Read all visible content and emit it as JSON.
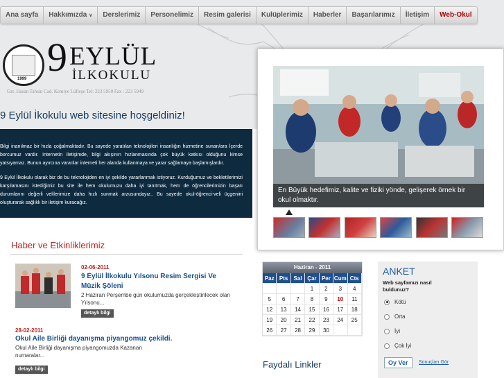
{
  "nav": {
    "items": [
      "Ana sayfa",
      "Hakkımızda",
      "Derslerimiz",
      "Personelimiz",
      "Resim galerisi",
      "Kulüplerimiz",
      "Haberler",
      "Başarılarımız",
      "İletişim",
      "Web-Okul"
    ]
  },
  "header": {
    "logo_number": "9",
    "logo_name": "EYLÜL",
    "logo_sub": "İLKOKULU",
    "seal_text": "9 EYLÜL İLKOKULU MÜDÜRLÜĞÜ",
    "seal_year": "1999",
    "address": "Gzt. Hasan Tahsin Cad. Kemiye Lüfleşe Tel: 223 5950  Fax : 223 5949"
  },
  "welcome": {
    "title": "9 Eylül İkokulu web sitesine hoşgeldiniz!",
    "paragraphs": [
      "Bilgi inanılmaz bir hızla çoğalmaktadır. Bu sayede yaratılan teknolojileri insanlığın hizmetine sunan/ara İçerde borcumuz vardır. Internetin iletişimde, bilgi akışının hızlanmasında çok büyük katkısı olduğunu kimse yatsıyamaz. Bunun ayırcına varanlar interneti her alanda kullanmaya ve yarar sağlamaya başlamışlardır.",
      "9 Eylül İlkokulu olarak biz de bu teknolojiden en iyi şekilde yararlanmak istiyoruz. Kurduğumuz ve bekletilerimizi karşılamasını istediğimiz bu site ile hem okulumuzu daha iyi tanıtmak, hem de öğrencilerimizin başarı durumlarını değerli velilerimize daha hızlı sunmak arzusundayız.. Bu sayede okul-öğrenci-veli üçgenini oluşturarak sağlıklı bir iletişim kuracağız."
    ]
  },
  "slider": {
    "caption": "En Büyük hedefimiz, kalite ve fiziki yönde, gelişerek örnek  bir okul olmaktır."
  },
  "news": {
    "title": "Haber ve Etkinliklerimiz",
    "items": [
      {
        "date": "02-06-2011",
        "title": "9 Eylül İlkokulu Yılsonu Resim Sergisi Ve Müzik Şöleni",
        "summary": "2 Haziran Perşembe gün okulumuzda gerçekleştirilecek olan Yılsonu...",
        "button": "detaylı bilgi"
      },
      {
        "date": "28-02-2011",
        "title": "Okul Aile Birliği dayanışma piyangomuz çekildi.",
        "summary": "Okul Aile Birliği dayanışma piyangomuzda Kazanan numaralar...",
        "button": "detaylı bilgi"
      }
    ]
  },
  "calendar": {
    "month": "Haziran - 2011",
    "day_names": [
      "Paz",
      "Pts",
      "Sal",
      "Çar",
      "Per",
      "Cum",
      "Cts"
    ],
    "weeks": [
      [
        "",
        "",
        "",
        "1",
        "2",
        "3",
        "4"
      ],
      [
        "5",
        "6",
        "7",
        "8",
        "9",
        "10",
        "11"
      ],
      [
        "12",
        "13",
        "14",
        "15",
        "16",
        "17",
        "18"
      ],
      [
        "19",
        "20",
        "21",
        "22",
        "23",
        "24",
        "25"
      ],
      [
        "26",
        "27",
        "28",
        "29",
        "30",
        "",
        ""
      ]
    ],
    "today": "10"
  },
  "links": {
    "title": "Faydalı Linkler"
  },
  "poll": {
    "title": "ANKET",
    "question": "Web sayfamızı nasıl buldunuz?",
    "options": [
      "Kötü",
      "Orta",
      "İyi",
      "Çok İyi"
    ],
    "selected": "Kötü",
    "vote_label": "Oy Ver",
    "results_label": "Sonuçları Gör"
  },
  "colors": {
    "nav_highlight": "#b00000",
    "intro_bg": "#0e2a3f",
    "news_title": "#c82020",
    "calendar_header": "#1e4f8f"
  }
}
